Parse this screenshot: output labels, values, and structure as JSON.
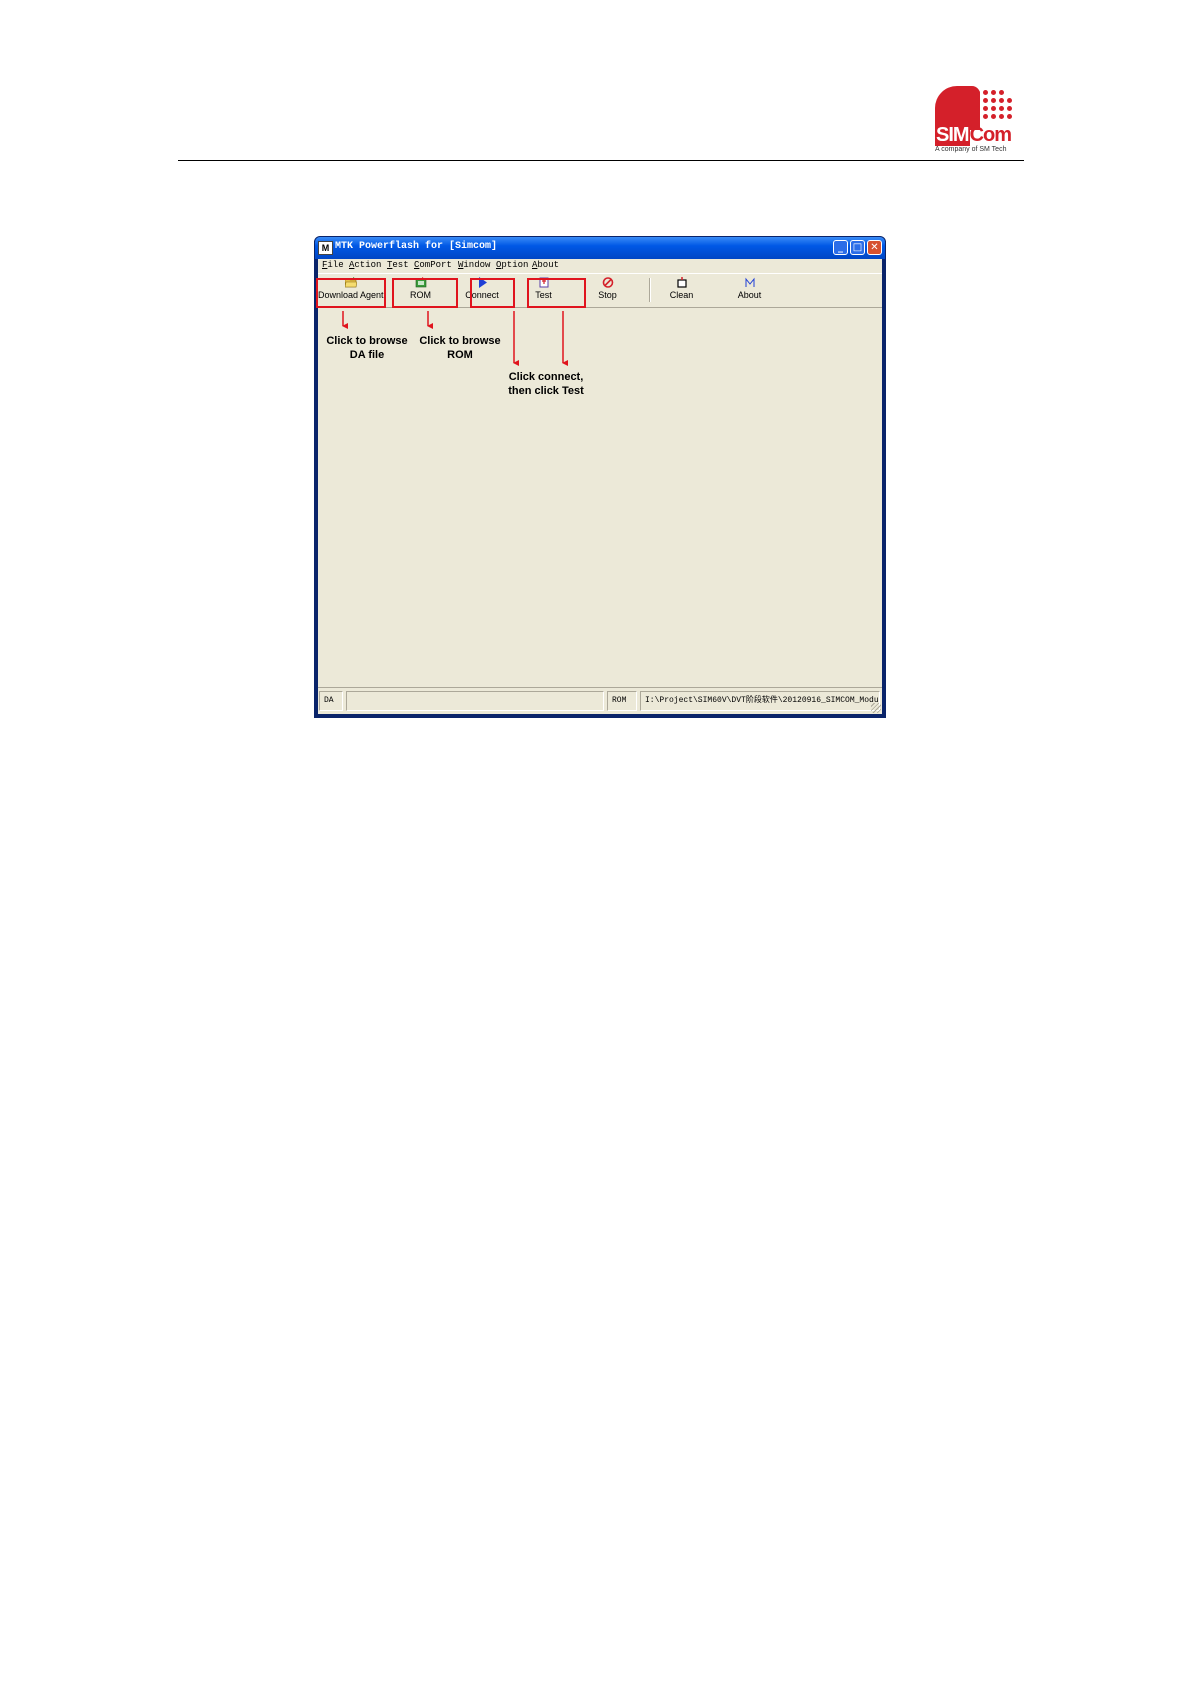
{
  "logo": {
    "brand_sim": "SIM",
    "brand_com": "Com",
    "tagline": "A company of SM Tech",
    "accent": "#d4202a"
  },
  "window": {
    "title": "MTK Powerflash for [Simcom]",
    "app_icon_letter": "M",
    "controls": {
      "minimize": "_",
      "maximize": "□",
      "close": "✕"
    }
  },
  "menu": [
    "File",
    "Action",
    "Test",
    "ComPort",
    "Window",
    "Option",
    "About"
  ],
  "toolbar": [
    {
      "label": "Download Agent",
      "icon": "open-folder-icon"
    },
    {
      "label": "ROM",
      "icon": "rom-chip-icon"
    },
    {
      "label": "Connect",
      "icon": "play-triangle-icon"
    },
    {
      "label": "Test",
      "icon": "test-icon"
    },
    {
      "label": "Stop",
      "icon": "stop-circle-icon"
    },
    {
      "label": "Clean",
      "icon": "clean-icon"
    },
    {
      "label": "About",
      "icon": "about-m-icon"
    }
  ],
  "annotations": {
    "da": [
      "Click to browse",
      "DA file"
    ],
    "rom": [
      "Click to browse",
      "ROM"
    ],
    "connect": [
      "Click connect,",
      "then click Test"
    ],
    "color": "#e0141e"
  },
  "statusbar": {
    "da_label": "DA",
    "da_value": "",
    "rom_label": "ROM",
    "rom_value": "I:\\Project\\SIM60V\\DVT阶段软件\\20120916_SIMCOM_Modu"
  }
}
